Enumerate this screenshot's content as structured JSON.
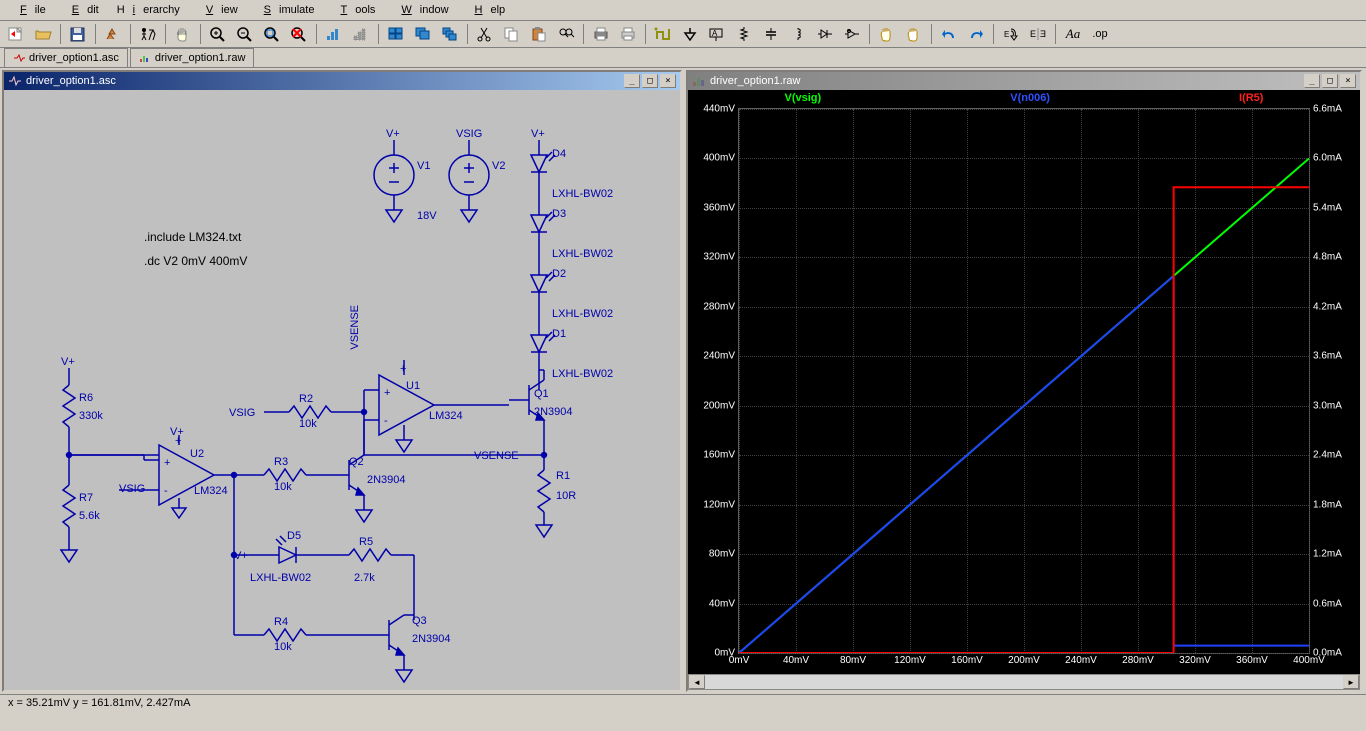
{
  "menu": [
    "File",
    "Edit",
    "Hierarchy",
    "View",
    "Simulate",
    "Tools",
    "Window",
    "Help"
  ],
  "tabs": [
    {
      "icon": "schematic",
      "label": "driver_option1.asc"
    },
    {
      "icon": "wave",
      "label": "driver_option1.raw"
    }
  ],
  "panel_left": {
    "title": "driver_option1.asc"
  },
  "panel_right": {
    "title": "driver_option1.raw"
  },
  "directives": {
    "include": ".include LM324.txt",
    "dc": ".dc V2 0mV 400mV"
  },
  "components": {
    "V1": {
      "name": "V1",
      "val": "18V"
    },
    "V2": {
      "name": "V2",
      "val": ""
    },
    "D4": {
      "name": "D4",
      "val": "LXHL-BW02"
    },
    "D3": {
      "name": "D3",
      "val": "LXHL-BW02"
    },
    "D2": {
      "name": "D2",
      "val": "LXHL-BW02"
    },
    "D1": {
      "name": "D1",
      "val": "LXHL-BW02"
    },
    "Q1": {
      "name": "Q1",
      "val": "2N3904"
    },
    "Q2": {
      "name": "Q2",
      "val": "2N3904"
    },
    "Q3": {
      "name": "Q3",
      "val": "2N3904"
    },
    "U1": {
      "name": "U1",
      "val": "LM324"
    },
    "U2": {
      "name": "U2",
      "val": "LM324"
    },
    "R1": {
      "name": "R1",
      "val": "10R"
    },
    "R2": {
      "name": "R2",
      "val": "10k"
    },
    "R3": {
      "name": "R3",
      "val": "10k"
    },
    "R4": {
      "name": "R4",
      "val": "10k"
    },
    "R5": {
      "name": "R5",
      "val": "2.7k"
    },
    "R6": {
      "name": "R6",
      "val": "330k"
    },
    "R7": {
      "name": "R7",
      "val": "5.6k"
    },
    "D5": {
      "name": "D5",
      "val": "LXHL-BW02"
    }
  },
  "nets": {
    "vplus": "V+",
    "vsig": "VSIG",
    "vsense": "VSENSE"
  },
  "chart_data": {
    "type": "line",
    "title": "",
    "xlabel": "",
    "ylabel_left": "",
    "ylabel_right": "",
    "x_ticks": [
      "0mV",
      "40mV",
      "80mV",
      "120mV",
      "160mV",
      "200mV",
      "240mV",
      "280mV",
      "320mV",
      "360mV",
      "400mV"
    ],
    "y_ticks_left": [
      "0mV",
      "40mV",
      "80mV",
      "120mV",
      "160mV",
      "200mV",
      "240mV",
      "280mV",
      "320mV",
      "360mV",
      "400mV",
      "440mV"
    ],
    "y_ticks_right": [
      "0.0mA",
      "0.6mA",
      "1.2mA",
      "1.8mA",
      "2.4mA",
      "3.0mA",
      "3.6mA",
      "4.2mA",
      "4.8mA",
      "5.4mA",
      "6.0mA",
      "6.6mA"
    ],
    "xlim": [
      0,
      400
    ],
    "ylim_left": [
      0,
      440
    ],
    "ylim_right": [
      0,
      6.6
    ],
    "series": [
      {
        "name": "V(vsig)",
        "color": "#00ff00",
        "axis": "left",
        "x": [
          0,
          400
        ],
        "y": [
          0,
          400
        ]
      },
      {
        "name": "V(n006)",
        "color": "#2040ff",
        "axis": "left",
        "x": [
          0,
          305,
          305,
          400
        ],
        "y": [
          0,
          305,
          6,
          6
        ]
      },
      {
        "name": "I(R5)",
        "color": "#ff0000",
        "axis": "right",
        "x": [
          0,
          305,
          305,
          400
        ],
        "y": [
          0,
          0,
          5.65,
          5.65
        ]
      }
    ]
  },
  "status": {
    "text": "x = 35.21mV   y = 161.81mV, 2.427mA"
  }
}
